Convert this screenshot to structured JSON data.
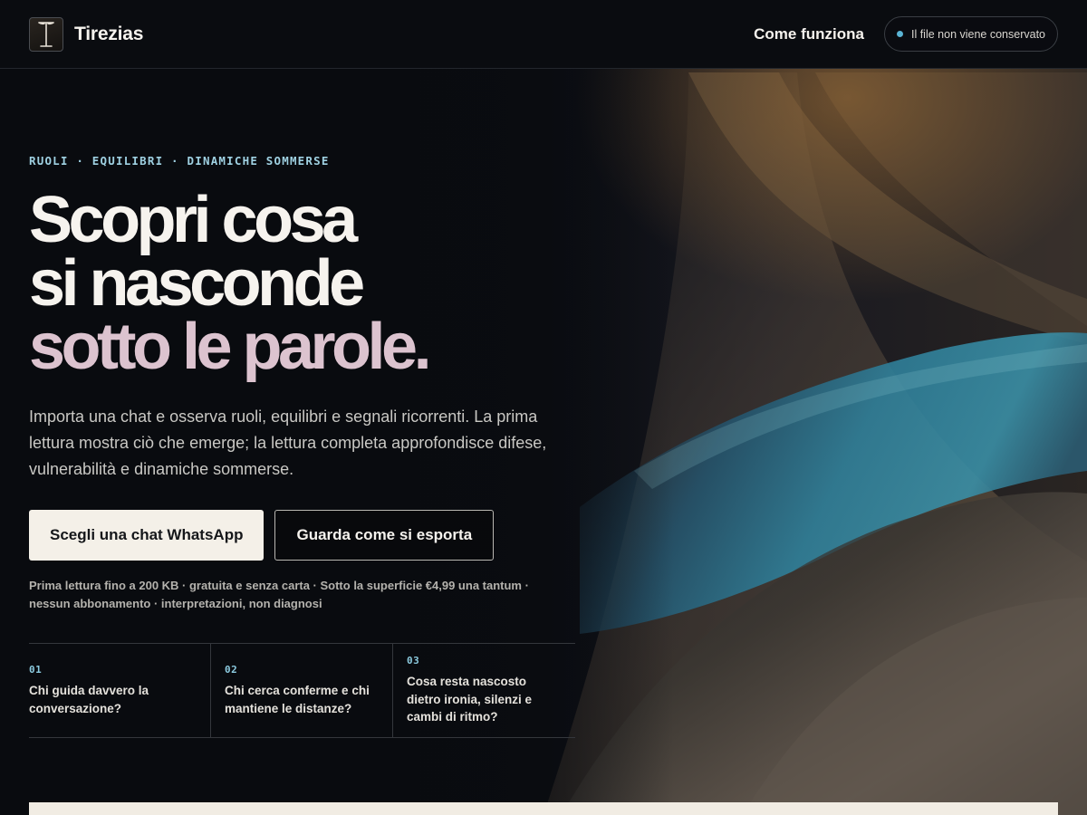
{
  "brand": {
    "name": "Tirezias"
  },
  "nav": {
    "how_it_works": "Come funziona",
    "privacy_note": "Il file non viene conservato"
  },
  "hero": {
    "eyebrow": "RUOLI · EQUILIBRI · DINAMICHE SOMMERSE",
    "headline": {
      "line1": "Scopri cosa",
      "line2": "si nasconde",
      "line3": "sotto le parole."
    },
    "lead": "Importa una chat e osserva ruoli, equilibri e segnali ricorrenti. La prima lettura mostra ciò che emerge; la lettura completa approfondisce difese, vulnerabilità e dinamiche sommerse.",
    "primary_cta": "Scegli una chat WhatsApp",
    "secondary_cta": "Guarda come si esporta",
    "fineprint": "Prima lettura fino a 200 KB · gratuita e senza carta · Sotto la superficie €4,99 una tantum · nessun abbonamento · interpretazioni, non diagnosi"
  },
  "questions": [
    {
      "num": "01",
      "text": "Chi guida davvero la conversazione?"
    },
    {
      "num": "02",
      "text": "Chi cerca conferme e chi mantiene le distanze?"
    },
    {
      "num": "03",
      "text": "Cosa resta nascosto dietro ironia, silenzi e cambi di ritmo?"
    }
  ],
  "colors": {
    "background": "#090b0f",
    "accent_cyan": "#9fd1e2",
    "accent_pink": "#dcc3cf",
    "button_light": "#f4f0e8"
  },
  "icons": {
    "logo": "serif-I-logo-icon",
    "privacy": "status-dot-icon"
  }
}
